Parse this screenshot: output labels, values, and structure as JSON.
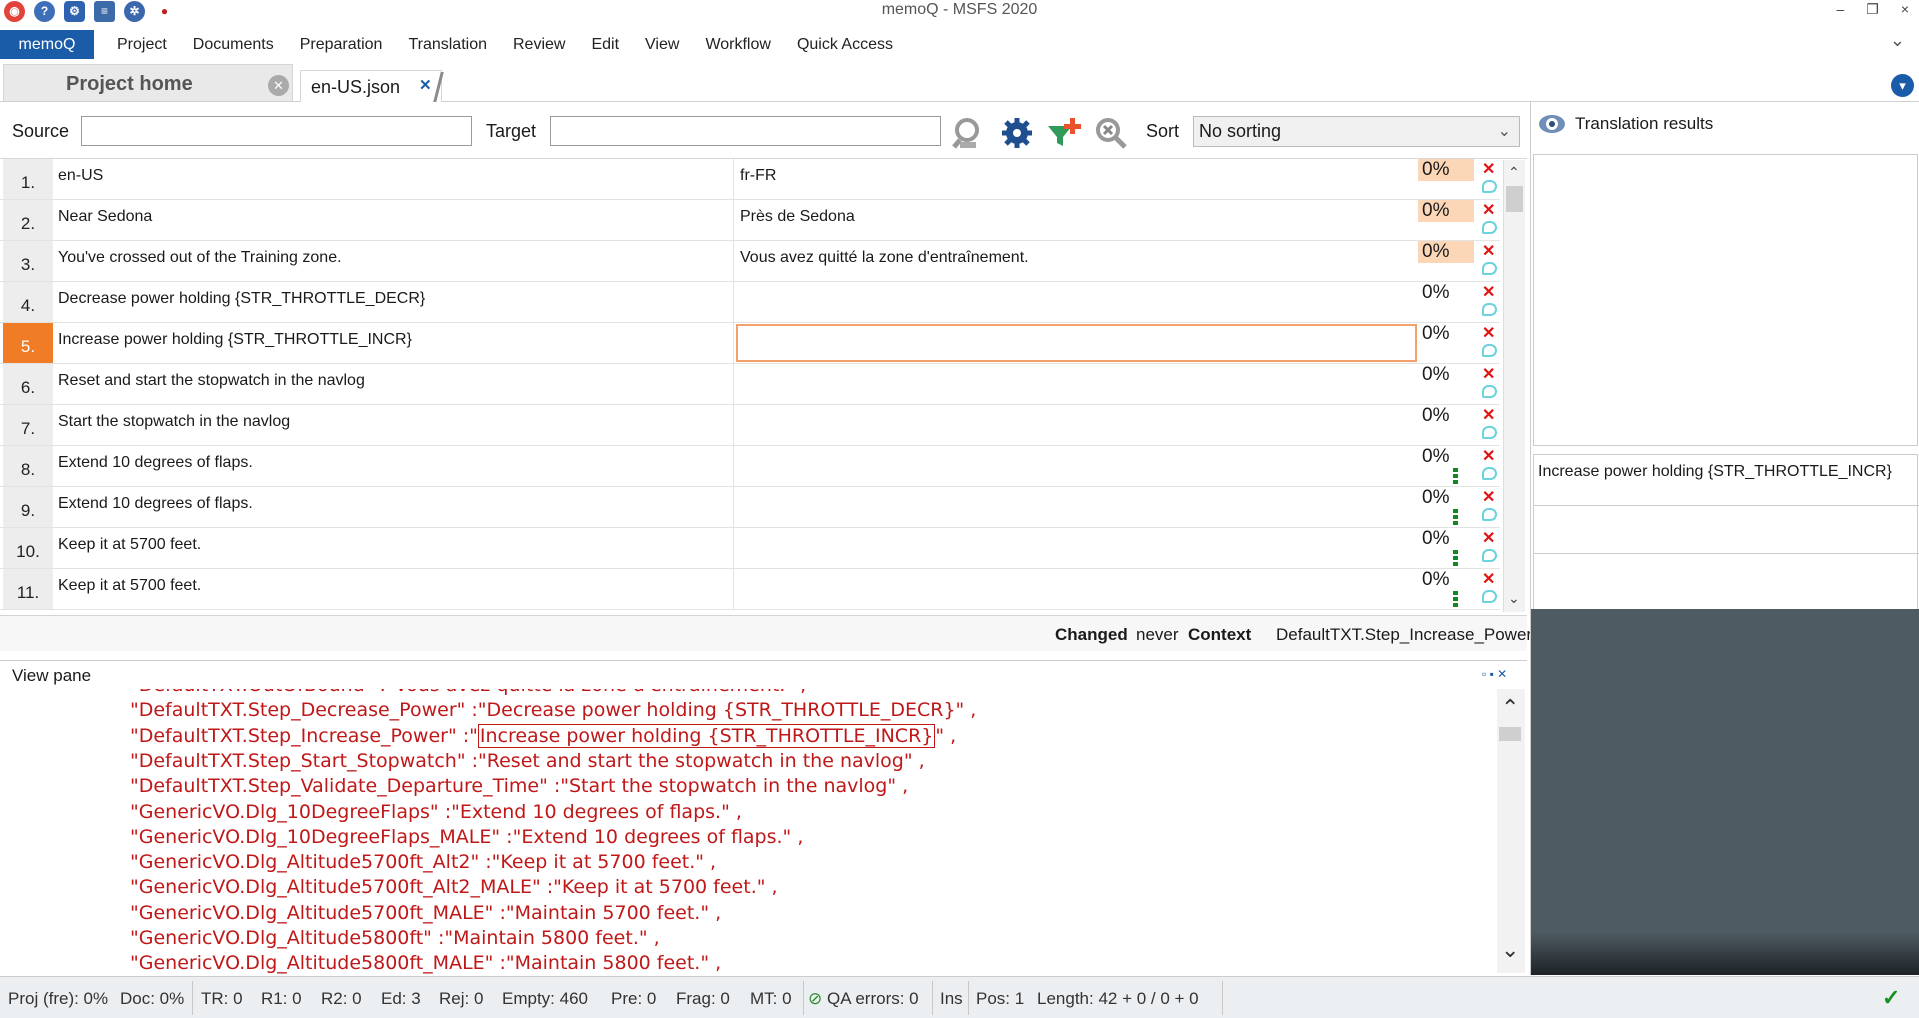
{
  "window": {
    "title": "memoQ - MSFS 2020",
    "minimize": "–",
    "restore": "❐",
    "close": "×"
  },
  "ribbon": {
    "app_tab": "memoQ",
    "tabs": [
      "Project",
      "Documents",
      "Preparation",
      "Translation",
      "Review",
      "Edit",
      "View",
      "Workflow",
      "Quick Access"
    ]
  },
  "doctabs": {
    "home": "Project home",
    "file": "en-US.json"
  },
  "filter": {
    "source_label": "Source",
    "target_label": "Target",
    "source_value": "",
    "target_value": "",
    "sort_label": "Sort",
    "sort_value": "No sorting"
  },
  "rows": [
    {
      "num": "1.",
      "source": "en-US",
      "target": "fr-FR",
      "pct": "0%"
    },
    {
      "num": "2.",
      "source": "Near Sedona",
      "target": "Près de Sedona",
      "pct": "0%"
    },
    {
      "num": "3.",
      "source": "You've crossed out of the Training zone.",
      "target": "Vous avez quitté la zone d'entraînement.",
      "pct": "0%"
    },
    {
      "num": "4.",
      "source": "Decrease power holding {STR_THROTTLE_DECR}",
      "target": "",
      "pct": "0%"
    },
    {
      "num": "5.",
      "source": "Increase power holding {STR_THROTTLE_INCR}",
      "target": "",
      "pct": "0%"
    },
    {
      "num": "6.",
      "source": "Reset and start the stopwatch in the navlog",
      "target": "",
      "pct": "0%"
    },
    {
      "num": "7.",
      "source": "Start the stopwatch in the navlog",
      "target": "",
      "pct": "0%"
    },
    {
      "num": "8.",
      "source": "Extend 10 degrees of flaps.",
      "target": "",
      "pct": "0%"
    },
    {
      "num": "9.",
      "source": "Extend 10 degrees of flaps.",
      "target": "",
      "pct": "0%"
    },
    {
      "num": "10.",
      "source": "Keep it at 5700 feet.",
      "target": "",
      "pct": "0%"
    },
    {
      "num": "11.",
      "source": "Keep it at 5700 feet.",
      "target": "",
      "pct": "0%"
    }
  ],
  "segment_info": {
    "changed_label": "Changed",
    "changed_value": "never",
    "context_label": "Context",
    "context_value": "DefaultTXT.Step_Increase_Power"
  },
  "view_pane": {
    "title": "View pane",
    "controls": "▫ ▪ ✕",
    "lines": [
      "\"DefaultTXT.OutOfBound\" :\"Vous avez quitté la zone d'entraînement.\" ,",
      "\"DefaultTXT.Step_Decrease_Power\" :\"Decrease power holding {STR_THROTTLE_DECR}\" ,",
      "\"DefaultTXT.Step_Increase_Power\" :\"",
      "\"DefaultTXT.Step_Start_Stopwatch\" :\"Reset and start the stopwatch in the navlog\" ,",
      "\"DefaultTXT.Step_Validate_Departure_Time\" :\"Start the stopwatch in the navlog\" ,",
      "\"GenericVO.Dlg_10DegreeFlaps\" :\"Extend 10 degrees of flaps.\" ,",
      "\"GenericVO.Dlg_10DegreeFlaps_MALE\" :\"Extend 10 degrees of flaps.\" ,",
      "\"GenericVO.Dlg_Altitude5700ft_Alt2\" :\"Keep it at 5700 feet.\" ,",
      "\"GenericVO.Dlg_Altitude5700ft_Alt2_MALE\" :\"Keep it at 5700 feet.\" ,",
      "\"GenericVO.Dlg_Altitude5700ft_MALE\" :\"Maintain 5700 feet.\" ,",
      "\"GenericVO.Dlg_Altitude5800ft\" :\"Maintain 5800 feet.\" ,",
      "\"GenericVO.Dlg_Altitude5800ft_MALE\" :\"Maintain 5800 feet.\" ,"
    ],
    "active_highlight": "Increase power holding {STR_THROTTLE_INCR}",
    "active_suffix": "\" ,"
  },
  "translation_results": {
    "title": "Translation results",
    "source_preview": "Increase power holding {STR_THROTTLE_INCR}"
  },
  "statusbar": {
    "proj": "Proj (fre): 0%",
    "doc": "Doc: 0%",
    "tr": "TR: 0",
    "r1": "R1: 0",
    "r2": "R2: 0",
    "ed": "Ed: 3",
    "rej": "Rej: 0",
    "empty": "Empty: 460",
    "pre": "Pre: 0",
    "frag": "Frag: 0",
    "mt": "MT: 0",
    "qa": "QA errors: 0",
    "ins": "Ins",
    "pos": "Pos: 1",
    "length": "Length: 42 + 0 / 0 + 0"
  },
  "colors": {
    "accent": "#1b5ca8",
    "active_row": "#f07c25",
    "match_bg": "#fbd7b7",
    "view_text": "#c01818"
  }
}
